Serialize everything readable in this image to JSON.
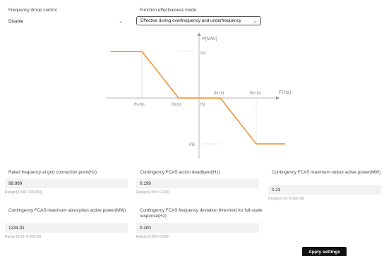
{
  "droop": {
    "label": "Frequency droop control",
    "value": "Disable"
  },
  "mode": {
    "label": "Function effectiveness mode",
    "value": "Effective during overfrequency and underfrequency"
  },
  "diagram": {
    "y_axis": "P(MW)",
    "x_axis": "F(Hz)",
    "pa": "PA",
    "pb": "PB",
    "fn_minus_fm": "fN-fm",
    "fn_minus_fd": "fN-fd",
    "fn": "fN",
    "fn_plus_fd": "fN+fd",
    "fn_plus_fm": "fN+fm"
  },
  "fields": [
    {
      "label": "Rated frequency at grid connection point(Hz)",
      "value": "99.999",
      "range": "Range:[0.000~100.000]"
    },
    {
      "label": "Contingency FCAS action deadband(Hz)",
      "value": "0.199",
      "range": "Range:[0.000~0.200]"
    },
    {
      "label": "Contingency FCAS maximum output active power(MW)",
      "value": "0.23",
      "range": "Range:[0.00~9,999.99]"
    },
    {
      "label": "Contingency FCAS maximum absorption active power(MW)",
      "value": "1234.31",
      "range": "Range:[0.00~9,999.99]"
    },
    {
      "label": "Contingency FCAS frequency deviation threshold for full-scale response(Hz)",
      "value": "0.200",
      "range": "Range:[0.000~0.500]"
    }
  ],
  "apply_label": "Apply settings",
  "colors": {
    "curve": "#f08a1c",
    "button": "#111111"
  }
}
